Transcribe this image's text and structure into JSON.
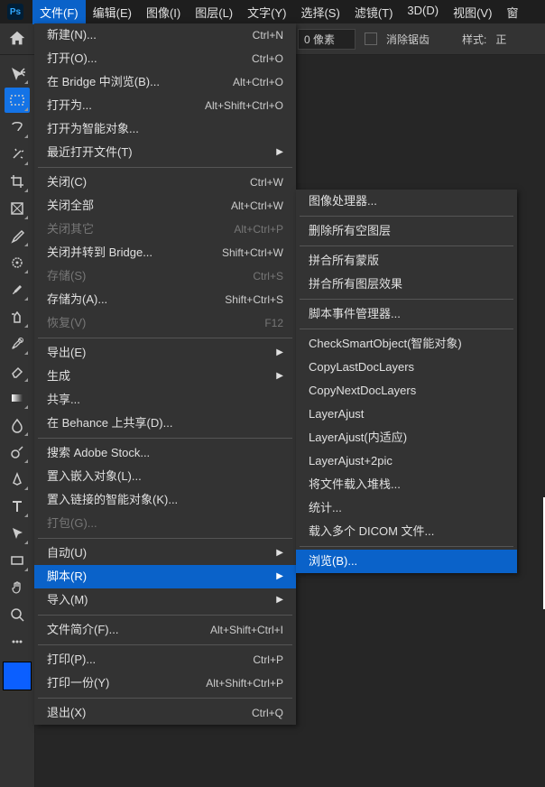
{
  "app": {
    "ps_label": "Ps"
  },
  "menubar": [
    "文件(F)",
    "编辑(E)",
    "图像(I)",
    "图层(L)",
    "文字(Y)",
    "选择(S)",
    "滤镜(T)",
    "3D(D)",
    "视图(V)",
    "窗"
  ],
  "options": {
    "px_value": "0 像素",
    "antialias": "消除锯齿",
    "style": "样式:",
    "normal": "正"
  },
  "file_menu": [
    {
      "label": "新建(N)...",
      "shortcut": "Ctrl+N"
    },
    {
      "label": "打开(O)...",
      "shortcut": "Ctrl+O"
    },
    {
      "label": "在 Bridge 中浏览(B)...",
      "shortcut": "Alt+Ctrl+O"
    },
    {
      "label": "打开为...",
      "shortcut": "Alt+Shift+Ctrl+O"
    },
    {
      "label": "打开为智能对象..."
    },
    {
      "label": "最近打开文件(T)",
      "submenu": true
    },
    {
      "sep": true
    },
    {
      "label": "关闭(C)",
      "shortcut": "Ctrl+W"
    },
    {
      "label": "关闭全部",
      "shortcut": "Alt+Ctrl+W"
    },
    {
      "label": "关闭其它",
      "shortcut": "Alt+Ctrl+P",
      "disabled": true
    },
    {
      "label": "关闭并转到 Bridge...",
      "shortcut": "Shift+Ctrl+W"
    },
    {
      "label": "存储(S)",
      "shortcut": "Ctrl+S",
      "disabled": true
    },
    {
      "label": "存储为(A)...",
      "shortcut": "Shift+Ctrl+S"
    },
    {
      "label": "恢复(V)",
      "shortcut": "F12",
      "disabled": true
    },
    {
      "sep": true
    },
    {
      "label": "导出(E)",
      "submenu": true
    },
    {
      "label": "生成",
      "submenu": true
    },
    {
      "label": "共享..."
    },
    {
      "label": "在 Behance 上共享(D)..."
    },
    {
      "sep": true
    },
    {
      "label": "搜索 Adobe Stock..."
    },
    {
      "label": "置入嵌入对象(L)..."
    },
    {
      "label": "置入链接的智能对象(K)..."
    },
    {
      "label": "打包(G)...",
      "disabled": true
    },
    {
      "sep": true
    },
    {
      "label": "自动(U)",
      "submenu": true
    },
    {
      "label": "脚本(R)",
      "submenu": true,
      "highlight": true
    },
    {
      "label": "导入(M)",
      "submenu": true
    },
    {
      "sep": true
    },
    {
      "label": "文件简介(F)...",
      "shortcut": "Alt+Shift+Ctrl+I"
    },
    {
      "sep": true
    },
    {
      "label": "打印(P)...",
      "shortcut": "Ctrl+P"
    },
    {
      "label": "打印一份(Y)",
      "shortcut": "Alt+Shift+Ctrl+P"
    },
    {
      "sep": true
    },
    {
      "label": "退出(X)",
      "shortcut": "Ctrl+Q"
    }
  ],
  "scripts_submenu": [
    {
      "label": "图像处理器..."
    },
    {
      "sep": true
    },
    {
      "label": "删除所有空图层"
    },
    {
      "sep": true
    },
    {
      "label": "拼合所有蒙版"
    },
    {
      "label": "拼合所有图层效果"
    },
    {
      "sep": true
    },
    {
      "label": "脚本事件管理器..."
    },
    {
      "sep": true
    },
    {
      "label": "CheckSmartObject(智能对象)"
    },
    {
      "label": "CopyLastDocLayers"
    },
    {
      "label": "CopyNextDocLayers"
    },
    {
      "label": "LayerAjust"
    },
    {
      "label": "LayerAjust(内适应)"
    },
    {
      "label": "LayerAjust+2pic"
    },
    {
      "label": "将文件载入堆栈..."
    },
    {
      "label": "统计..."
    },
    {
      "label": "载入多个 DICOM 文件..."
    },
    {
      "sep": true
    },
    {
      "label": "浏览(B)...",
      "highlight": true
    }
  ],
  "tools": [
    "move",
    "marquee",
    "lasso",
    "magic-wand",
    "crop",
    "frame",
    "eyedropper",
    "spot-heal",
    "brush",
    "clone",
    "history-brush",
    "eraser",
    "gradient",
    "blur",
    "dodge",
    "pen",
    "type",
    "path-select",
    "rectangle",
    "hand",
    "zoom",
    "more"
  ]
}
